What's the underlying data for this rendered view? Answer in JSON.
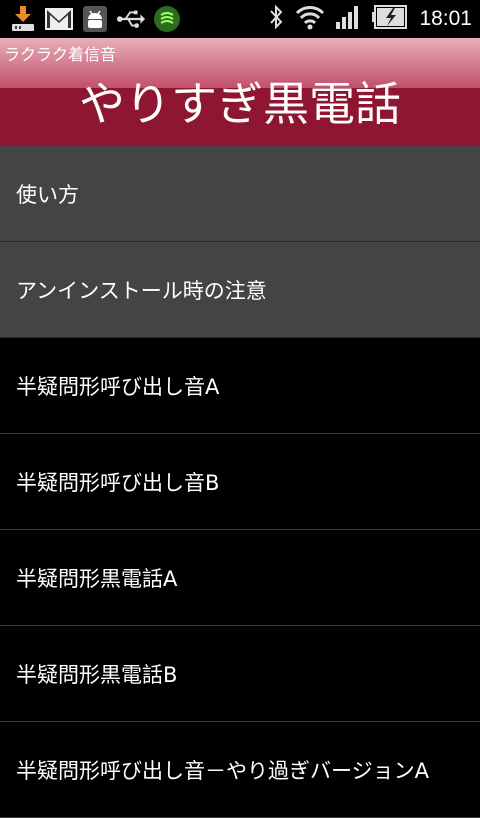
{
  "status_bar": {
    "time": "18:01",
    "left_icons": [
      "download-icon",
      "gmail-icon",
      "android-debug-icon",
      "usb-icon",
      "security-shield-icon"
    ],
    "right_icons": [
      "bluetooth-icon",
      "wifi-icon",
      "signal-icon",
      "battery-charging-icon"
    ]
  },
  "header": {
    "app_name": "ラクラク着信音",
    "title": "やりすぎ黒電話"
  },
  "menu": {
    "items": [
      {
        "label": "使い方"
      },
      {
        "label": "アンインストール時の注意"
      }
    ]
  },
  "ringtones": {
    "items": [
      {
        "label": "半疑問形呼び出し音A"
      },
      {
        "label": "半疑問形呼び出し音B"
      },
      {
        "label": "半疑問形黒電話A"
      },
      {
        "label": "半疑問形黒電話B"
      },
      {
        "label": "半疑問形呼び出し音－やり過ぎバージョンA"
      }
    ]
  },
  "colors": {
    "header": "#8e1630",
    "menu_bg": "#444444",
    "list_bg": "#000000"
  }
}
